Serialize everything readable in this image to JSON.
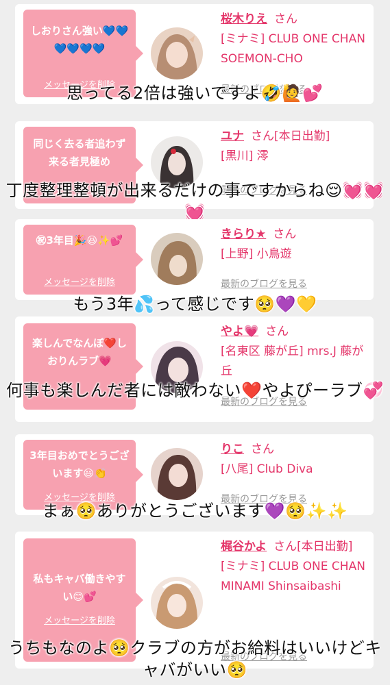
{
  "messages": [
    {
      "bubble": "しおりさん強い💙💙💙💙💙💙",
      "delete": "メッセージを削除",
      "name": "桜木りえ",
      "san": "さん",
      "shop": "[ミナミ] CLUB ONE CHAN SOEMON-CHO",
      "blog": "最新のブログを見る",
      "caption": "思ってる2倍は強いですよ🤣🙋💕",
      "avatar_colors": [
        "#f3d9c9",
        "#b78e73"
      ]
    },
    {
      "bubble": "同じく去る者追わず来る者見極め",
      "delete": "メッセージを削除",
      "name": "ユナ",
      "san": "さん[本日出勤]",
      "shop": "[黒川] 澪",
      "blog": "最新のブログを見る",
      "caption": "丁度整理整頓が出来るだけの事ですからね😌💓💓💓",
      "avatar_colors": [
        "#eceae8",
        "#3a3233"
      ]
    },
    {
      "bubble": "㊗3年目🎉😆✨💕",
      "delete": "メッセージを削除",
      "name": "きらり★",
      "san": "さん",
      "shop": "[上野] 小鳥遊",
      "blog": "最新のブログを見る",
      "caption": "もう3年💦って感じです🥺💜💛",
      "avatar_colors": [
        "#d8c9b6",
        "#9b7a5a"
      ]
    },
    {
      "bubble": "楽しんでなんぼ❤️しおりんラブ💗",
      "delete": "メッセージを削除",
      "name": "やよ💗",
      "san": "さん",
      "shop": "[名東区 藤が丘] mrs.J 藤が丘",
      "blog": "最新のブログを見る",
      "caption": "何事も楽しんだ者には敵わない❤️やよぴーラブ💞",
      "avatar_colors": [
        "#f2e3ea",
        "#4a3a48"
      ]
    },
    {
      "bubble": "3年目おめでとうございます😃👏",
      "delete": "メッセージを削除",
      "name": "りこ",
      "san": "さん",
      "shop": "[八尾] Club Diva",
      "blog": "最新のブログを見る",
      "caption": "まぁ🥺ありがとうございます💜🥺✨✨",
      "avatar_colors": [
        "#e8d0c8",
        "#5a3a35"
      ]
    },
    {
      "bubble": "私もキャバ働きやすい😊💕",
      "delete": "メッセージを削除",
      "name": "梶谷かよ",
      "san": "さん[本日出勤]",
      "shop": "[ミナミ] CLUB ONE CHAN MINAMI Shinsaibashi",
      "blog": "最新のブログを見る",
      "caption": "うちもなのよ🥺クラブの方がお給料はいいけどキャバがいい🥺",
      "avatar_colors": [
        "#f4e4dc",
        "#c99a72"
      ]
    }
  ]
}
